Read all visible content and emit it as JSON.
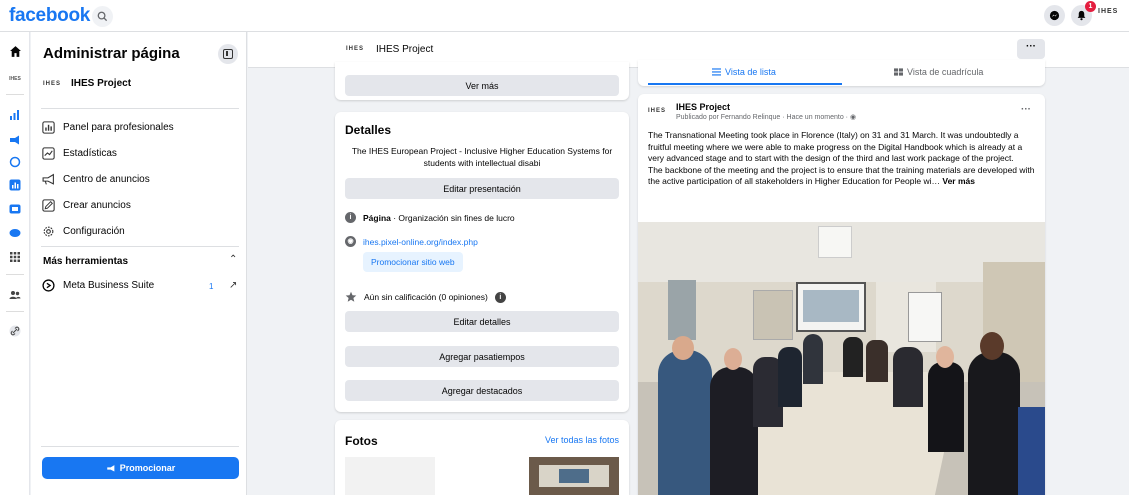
{
  "topbar": {
    "logo": "facebook",
    "notification_count": "1",
    "avatar_text": "IHES"
  },
  "rail": {
    "icons": [
      "home-icon",
      "page-logo-icon",
      "insights-icon",
      "megaphone-icon",
      "meta-icon",
      "stats-icon",
      "inbox-icon",
      "messenger-icon",
      "grid-icon",
      "people-icon",
      "link-icon"
    ]
  },
  "admin": {
    "title": "Administrar página",
    "page_logo": "IHES",
    "page_name": "IHES Project",
    "menu": [
      {
        "label": "Panel para profesionales",
        "icon": "dashboard-icon"
      },
      {
        "label": "Estadísticas",
        "icon": "chart-icon"
      },
      {
        "label": "Centro de anuncios",
        "icon": "megaphone-icon"
      },
      {
        "label": "Crear anuncios",
        "icon": "pencil-icon"
      },
      {
        "label": "Configuración",
        "icon": "gear-icon"
      }
    ],
    "more_tools": "Más herramientas",
    "business_suite": "Meta Business Suite",
    "business_suite_count": "1",
    "promote_label": "Promocionar"
  },
  "header": {
    "logo": "IHES",
    "page_name": "IHES Project",
    "more": "···"
  },
  "middle": {
    "see_more": "Ver más",
    "details_title": "Detalles",
    "details_desc": "The IHES European Project - Inclusive Higher Education Systems for students with intellectual disabi",
    "edit_presentation": "Editar presentación",
    "page_type_bold": "Página",
    "page_type_rest": " · Organización sin fines de lucro",
    "website": "ihes.pixel-online.org/index.php",
    "promote_site": "Promocionar sitio web",
    "rating": "Aún sin calificación (0 opiniones)",
    "edit_details": "Editar detalles",
    "add_hobbies": "Agregar pasatiempos",
    "add_featured": "Agregar destacados",
    "photos_title": "Fotos",
    "photos_all": "Ver todas las fotos"
  },
  "right": {
    "tab_list": "Vista de lista",
    "tab_grid": "Vista de cuadrícula",
    "post_logo": "IHES",
    "post_author": "IHES Project",
    "post_meta": "Publicado por Fernando Relinque · Hace un momento ·",
    "post_more": "···",
    "post_text": "The Transnational Meeting took place in Florence (Italy) on 31 and 31 March. It was undoubtedly a fruitful meeting where we were able to make progress on the Digital Handbook which is already at a very advanced stage and to start with the design of the third and last work package of the project.\nThe backbone of the meeting and the project is to ensure that the training materials are developed with the active participation of all stakeholders in Higher Education for People wi…",
    "post_see_more": "Ver más"
  },
  "colors": {
    "brand": "#1877f2",
    "background": "#f0f2f5",
    "badge": "#e41e3f"
  }
}
